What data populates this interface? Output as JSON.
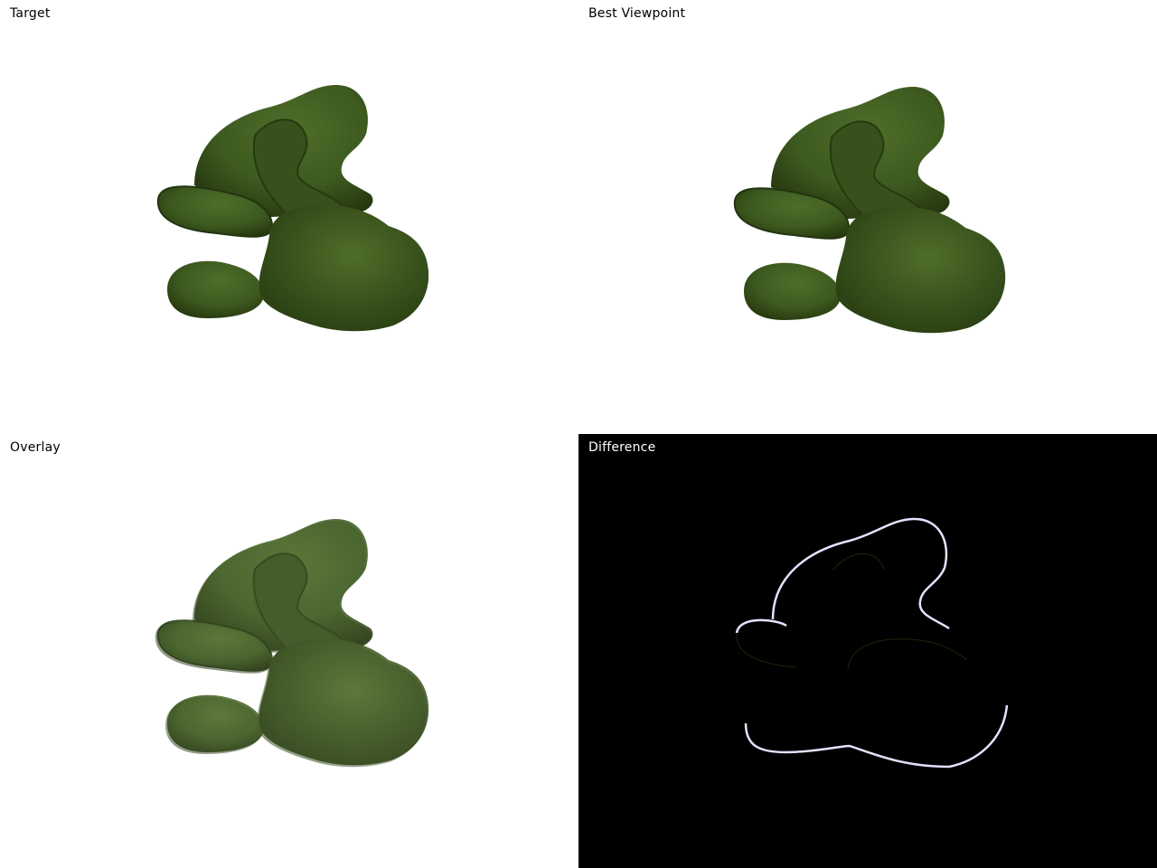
{
  "panels": {
    "target": {
      "label": "Target"
    },
    "best_viewpoint": {
      "label": "Best Viewpoint"
    },
    "overlay": {
      "label": "Overlay"
    },
    "difference": {
      "label": "Difference"
    }
  },
  "colors": {
    "model_green": "#3d5a1f",
    "model_dark": "#2a3f14",
    "model_light": "#4f6e2a",
    "difference_bg": "#000000",
    "difference_edge": "#e8e0ff"
  },
  "icons": {
    "model": "frog-model-render"
  }
}
